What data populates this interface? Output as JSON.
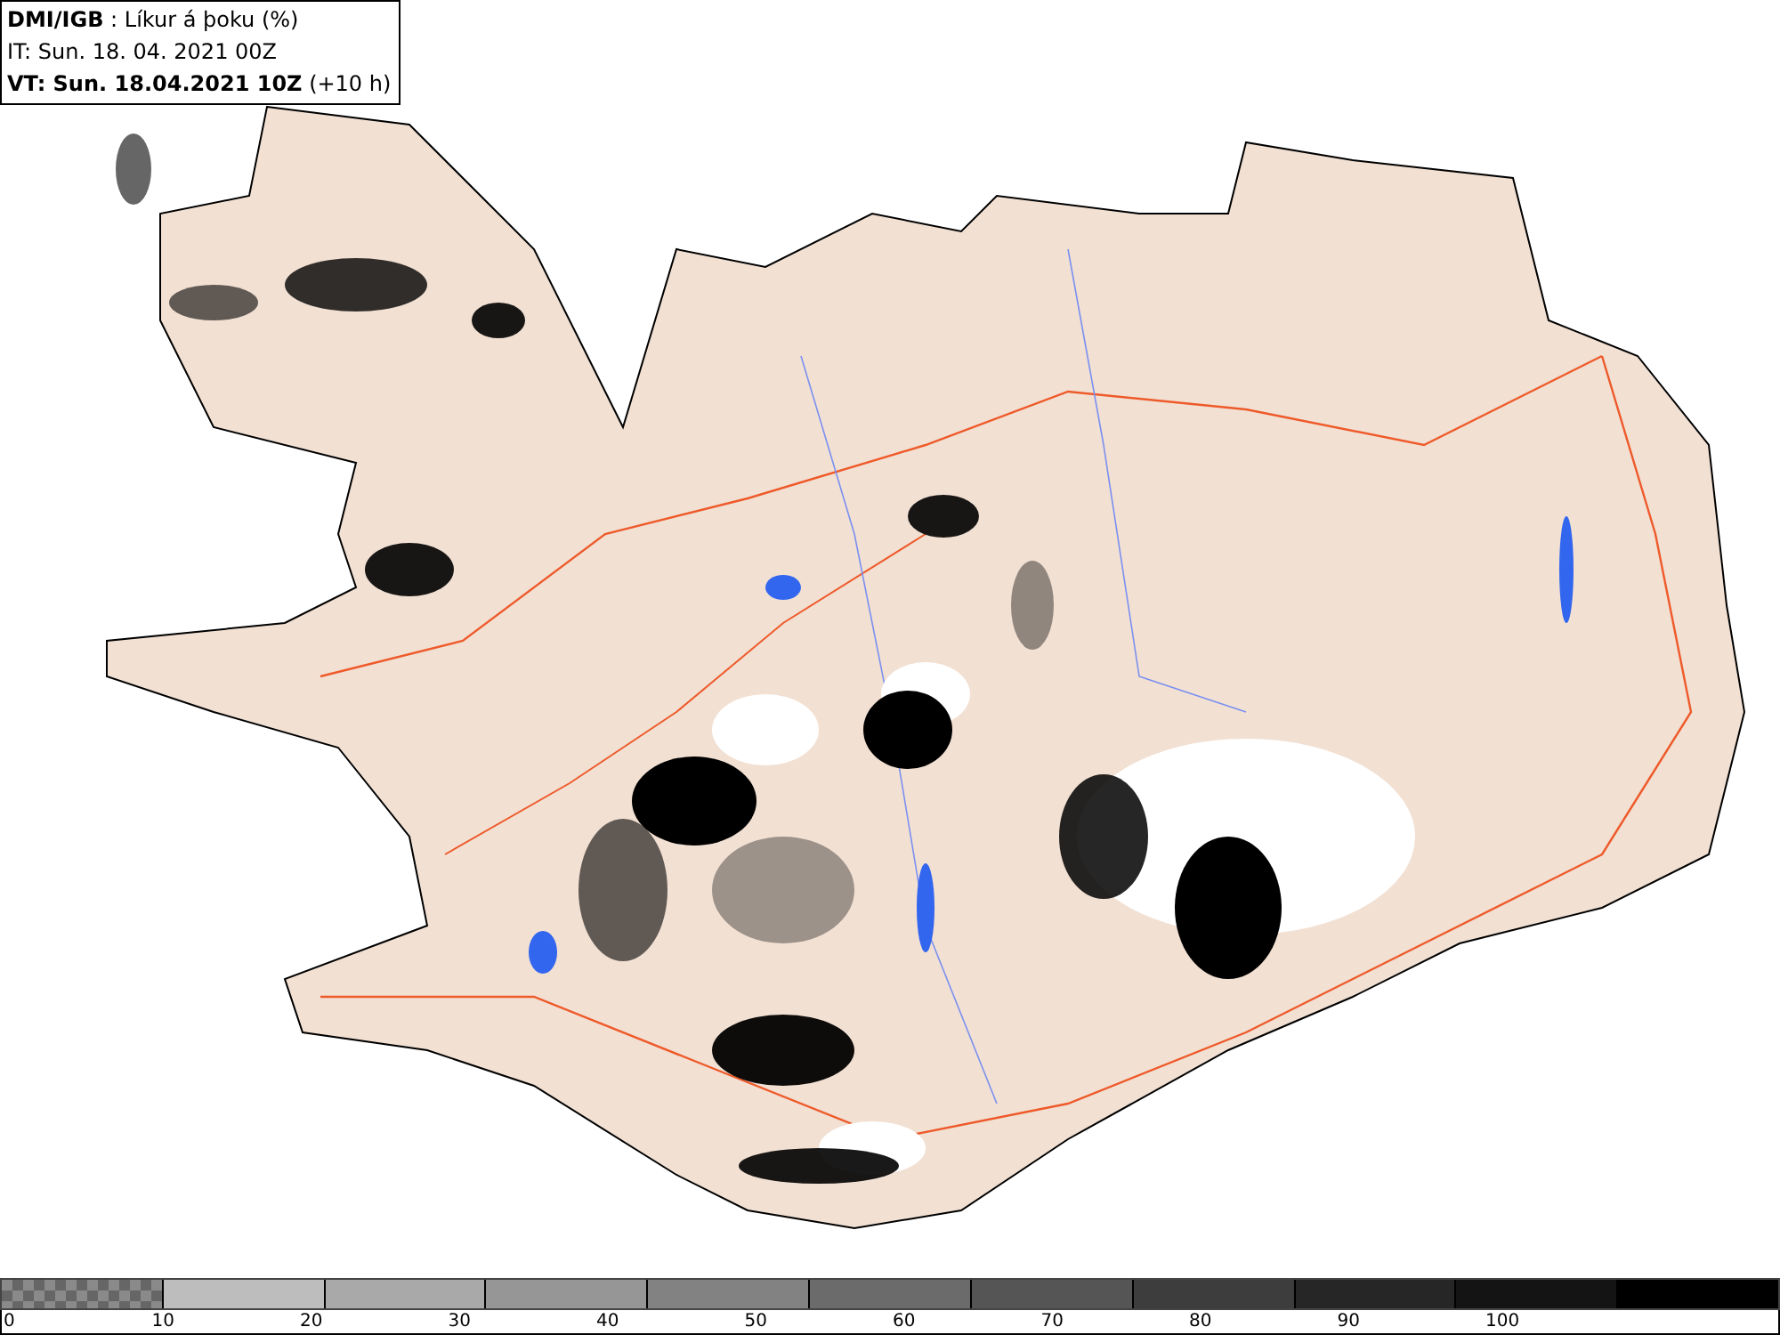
{
  "header": {
    "lines": [
      "**DMI/IGB** : Líkur á þoku (%)",
      "IT: Sun. 18. 04. 2021 00Z",
      "**VT: Sun. 18.04.2021 10Z** (+10 h)"
    ]
  },
  "legend": {
    "segments": [
      {
        "kind": "checker",
        "color": "#8a8a8a"
      },
      {
        "kind": "solid",
        "color": "#bdbdbd"
      },
      {
        "kind": "solid",
        "color": "#a9a9a9"
      },
      {
        "kind": "solid",
        "color": "#969696"
      },
      {
        "kind": "solid",
        "color": "#828282"
      },
      {
        "kind": "solid",
        "color": "#6b6b6b"
      },
      {
        "kind": "solid",
        "color": "#555555"
      },
      {
        "kind": "solid",
        "color": "#3d3d3d"
      },
      {
        "kind": "solid",
        "color": "#262626"
      },
      {
        "kind": "solid",
        "color": "#141414"
      },
      {
        "kind": "solid",
        "color": "#000000"
      }
    ],
    "labels": [
      "0",
      "10",
      "20",
      "30",
      "40",
      "50",
      "60",
      "70",
      "80",
      "90",
      "100"
    ]
  }
}
